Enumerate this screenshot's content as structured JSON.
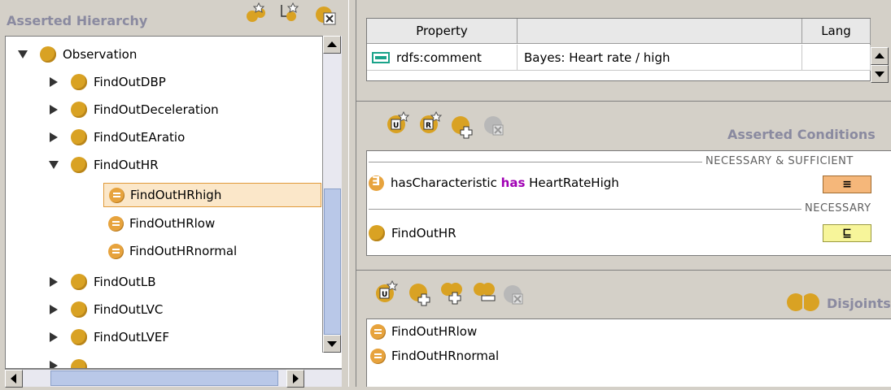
{
  "left_panel": {
    "title": "Asserted Hierarchy",
    "tree": [
      {
        "label": "Observation",
        "type": "class",
        "state": "expanded",
        "depth": 0
      },
      {
        "label": "FindOutDBP",
        "type": "class",
        "state": "collapsed",
        "depth": 1
      },
      {
        "label": "FindOutDeceleration",
        "type": "class",
        "state": "collapsed",
        "depth": 1
      },
      {
        "label": "FindOutEAratio",
        "type": "class",
        "state": "collapsed",
        "depth": 1
      },
      {
        "label": "FindOutHR",
        "type": "class",
        "state": "expanded",
        "depth": 1
      },
      {
        "label": "FindOutHRhigh",
        "type": "defined",
        "state": "leaf",
        "depth": 2,
        "selected": true
      },
      {
        "label": "FindOutHRlow",
        "type": "defined",
        "state": "leaf",
        "depth": 2
      },
      {
        "label": "FindOutHRnormal",
        "type": "defined",
        "state": "leaf",
        "depth": 2
      },
      {
        "label": "FindOutLB",
        "type": "class",
        "state": "collapsed",
        "depth": 1
      },
      {
        "label": "FindOutLVC",
        "type": "class",
        "state": "collapsed",
        "depth": 1
      },
      {
        "label": "FindOutLVEF",
        "type": "class",
        "state": "collapsed",
        "depth": 1
      }
    ]
  },
  "properties": {
    "headers": [
      "Property",
      "",
      "Lang"
    ],
    "rows": [
      {
        "property": "rdfs:comment",
        "value": "Bayes: Heart rate / high",
        "lang": ""
      }
    ]
  },
  "conditions": {
    "title": "Asserted Conditions",
    "nec_suff_label": "NECESSARY & SUFFICIENT",
    "necessary_label": "NECESSARY",
    "items": [
      {
        "prefix": "hasCharacteristic",
        "keyword": "has",
        "suffix": "HeartRateHigh",
        "badge": "≡"
      },
      {
        "label": "FindOutHR",
        "badge": "⊑"
      }
    ]
  },
  "disjoints": {
    "title": "Disjoints",
    "items": [
      "FindOutHRlow",
      "FindOutHRnormal"
    ]
  },
  "colors": {
    "class_icon": "#d9a223",
    "defined_icon": "#e7a33d",
    "keyword": "#a000b4",
    "panel_bg": "#d4d0c8",
    "title_text": "#8a8aa0"
  }
}
